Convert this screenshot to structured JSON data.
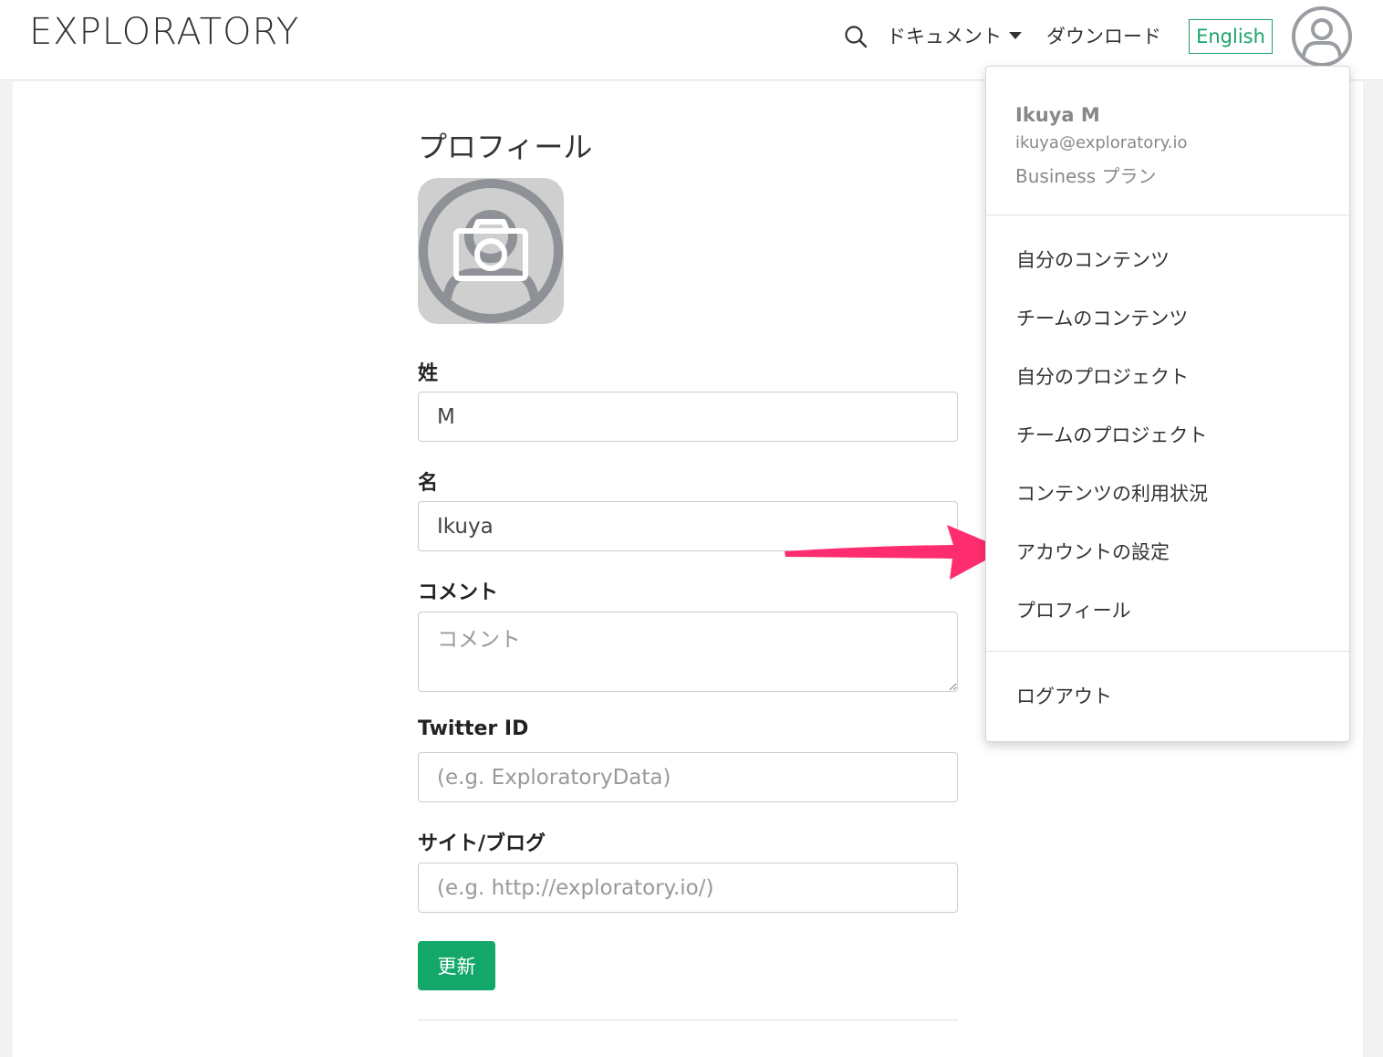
{
  "header": {
    "logo": "EXPLORATORY",
    "nav": {
      "docs_label": "ドキュメント",
      "download_label": "ダウンロード",
      "language_label": "English"
    },
    "icons": [
      "search-icon",
      "caret-down-icon",
      "user-avatar-icon"
    ]
  },
  "profile": {
    "title": "プロフィール",
    "photo_icon": "camera-icon",
    "last_name": {
      "label": "姓",
      "value": "M"
    },
    "first_name": {
      "label": "名",
      "value": "Ikuya"
    },
    "comment": {
      "label": "コメント",
      "placeholder": "コメント"
    },
    "twitter": {
      "label": "Twitter ID",
      "placeholder": "(e.g. ExploratoryData)"
    },
    "site": {
      "label": "サイト/ブログ",
      "placeholder": "(e.g. http://exploratory.io/)"
    },
    "update_label": "更新"
  },
  "user_menu": {
    "name": "Ikuya M",
    "email": "ikuya@exploratory.io",
    "plan": "Business プラン",
    "items": [
      {
        "label": "自分のコンテンツ"
      },
      {
        "label": "チームのコンテンツ"
      },
      {
        "label": "自分のプロジェクト"
      },
      {
        "label": "チームのプロジェクト"
      },
      {
        "label": "コンテンツの利用状況"
      },
      {
        "label": "アカウントの設定"
      },
      {
        "label": "プロフィール"
      }
    ],
    "logout_label": "ログアウト"
  },
  "colors": {
    "accent_green": "#13a86a",
    "annotation_arrow": "#ff2d6f"
  }
}
